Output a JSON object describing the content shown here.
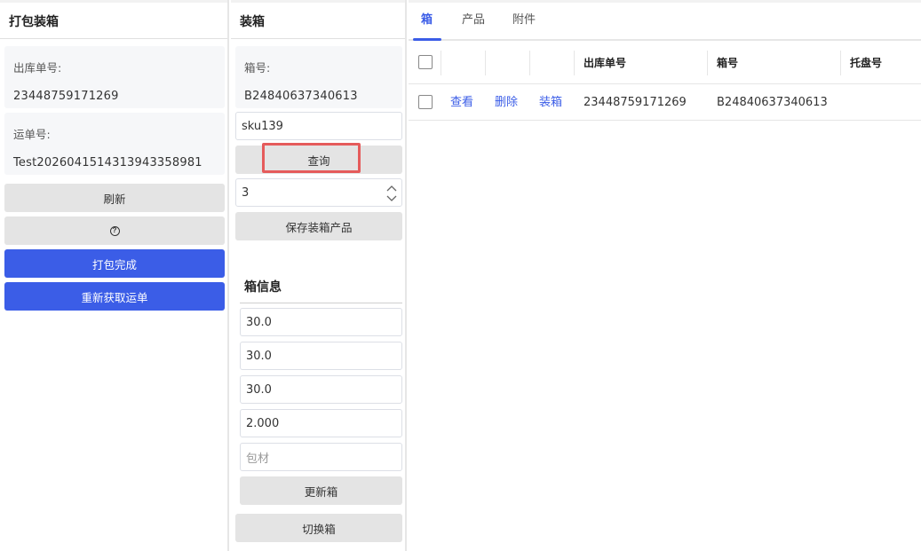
{
  "left": {
    "title": "打包装箱",
    "outbound_label": "出库单号:",
    "outbound_value": "23448759171269",
    "waybill_label": "运单号:",
    "waybill_value": "Test202604151431394335898​1",
    "refresh_label": "刷新",
    "help_label": "?",
    "pack_done_label": "打包完成",
    "refetch_label": "重新获取运单"
  },
  "mid": {
    "title": "装箱",
    "box_no_label": "箱号:",
    "box_no_value": "B24840637340613",
    "sku_value": "sku139",
    "query_label": "查询",
    "qty_value": "3",
    "save_label": "保存装箱产品",
    "box_info_title": "箱信息",
    "length_value": "30.0",
    "width_value": "30.0",
    "height_value": "30.0",
    "weight_value": "2.000",
    "material_placeholder": "包材",
    "update_label": "更新箱",
    "switch_label": "切换箱"
  },
  "right": {
    "tabs": [
      {
        "label": "箱",
        "active": true
      },
      {
        "label": "产品",
        "active": false
      },
      {
        "label": "附件",
        "active": false
      }
    ],
    "headers": {
      "outbound": "出库单号",
      "box_no": "箱号",
      "pallet": "托盘号"
    },
    "rows": [
      {
        "view": "查看",
        "delete": "删除",
        "pack": "装箱",
        "outbound": "23448759171269",
        "box_no": "B24840637340613",
        "pallet": ""
      }
    ]
  },
  "colors": {
    "primary": "#3b5de7",
    "button_gray": "#e4e4e4",
    "highlight": "#e55b5b"
  }
}
